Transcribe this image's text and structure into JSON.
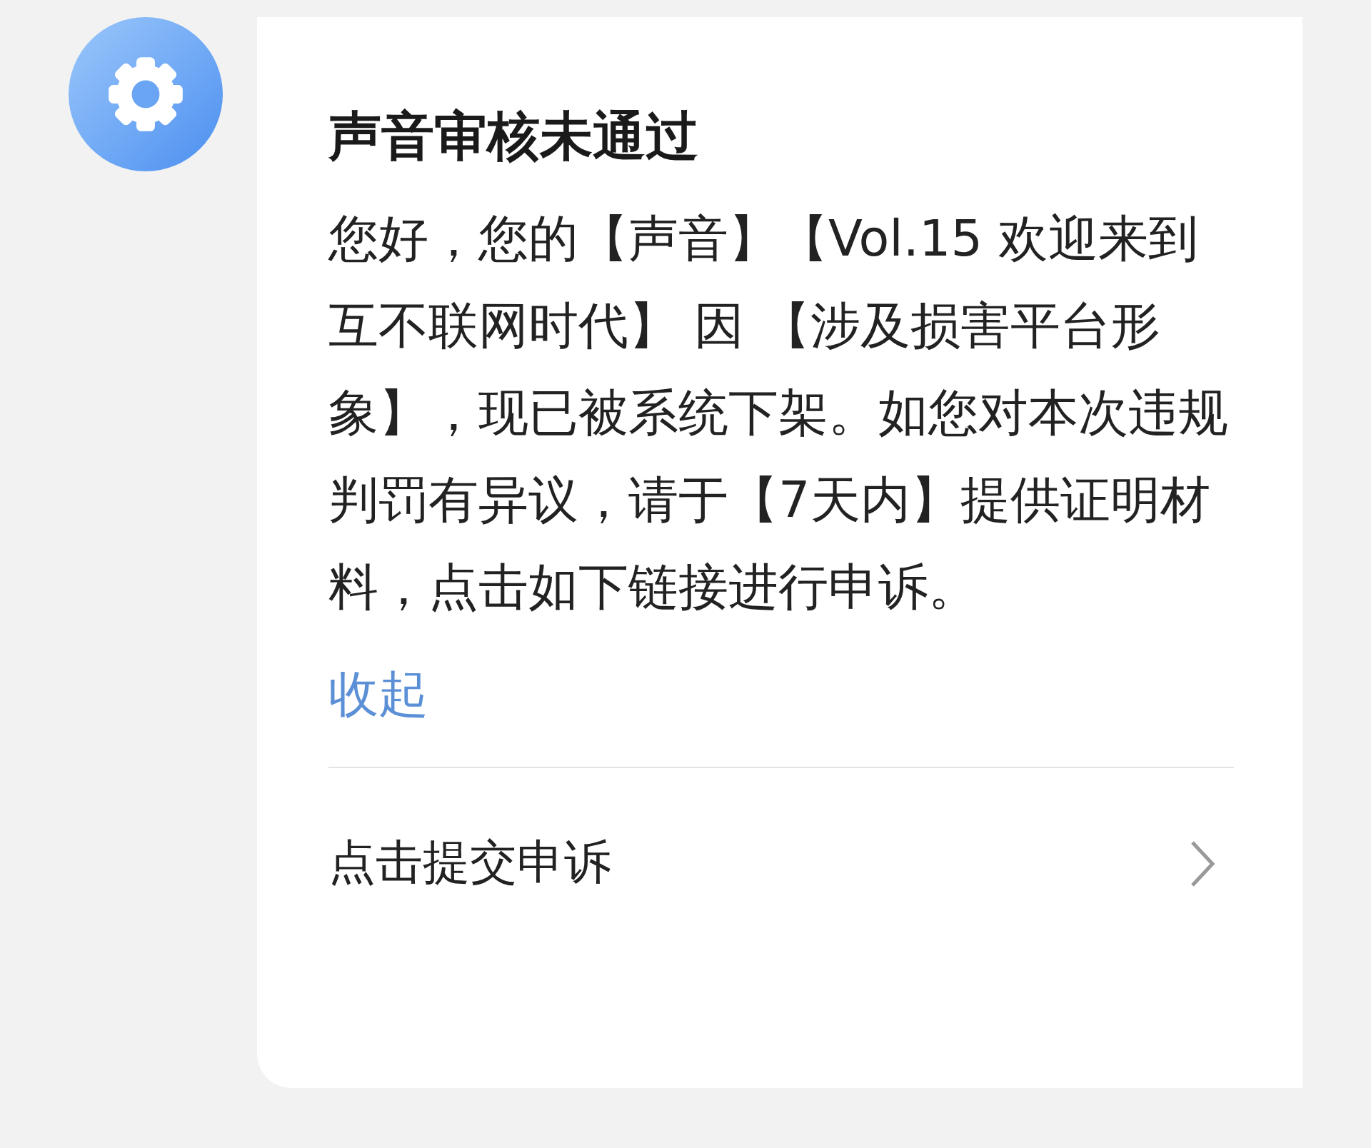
{
  "message": {
    "title": "声音审核未通过",
    "body": "您好，您的【声音】【Vol.15 欢迎来到互不联网时代】 因 【涉及损害平台形象】，现已被系统下架。如您对本次违规判罚有异议，请于【7天内】提供证明材料，点击如下链接进行申诉。",
    "collapse_link": "收起",
    "action": "点击提交申诉"
  }
}
